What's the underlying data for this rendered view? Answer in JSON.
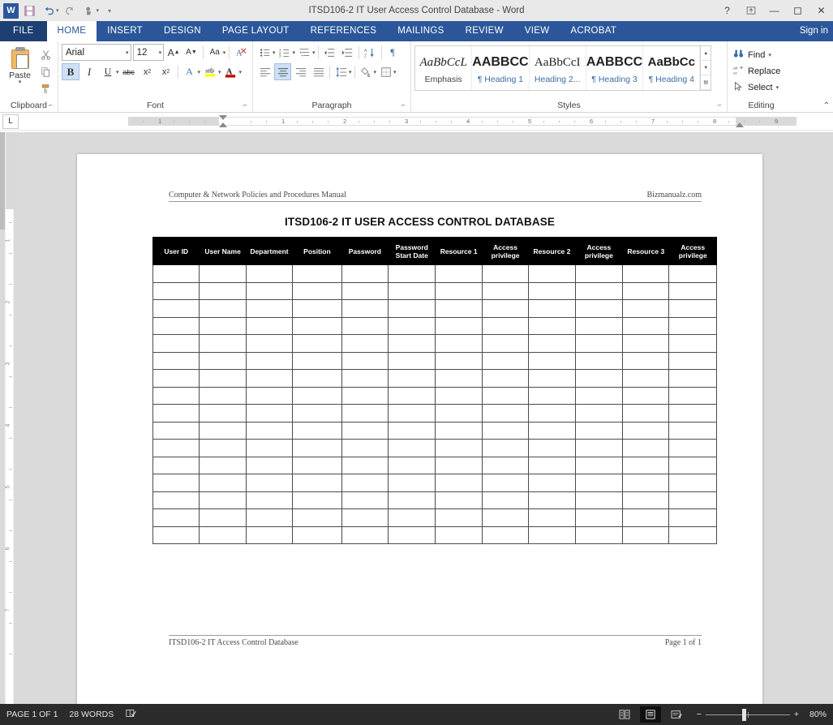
{
  "titlebar": {
    "app_logo": "word-logo",
    "logo_letter": "W",
    "title": "ITSD106-2 IT User Access Control Database - Word",
    "quick_access": [
      {
        "name": "save-icon",
        "label": "Save"
      },
      {
        "name": "undo-icon",
        "label": "Undo"
      },
      {
        "name": "redo-icon",
        "label": "Redo"
      },
      {
        "name": "touch-mode-icon",
        "label": "Touch/Mouse Mode"
      },
      {
        "name": "customize-qat-icon",
        "label": "Customize Quick Access Toolbar"
      }
    ],
    "window_controls": [
      {
        "name": "help-button",
        "glyph": "?"
      },
      {
        "name": "ribbon-display-options-button",
        "glyph": "⬜"
      },
      {
        "name": "minimize-button",
        "glyph": "—"
      },
      {
        "name": "maximize-button",
        "glyph": "▫"
      },
      {
        "name": "close-button",
        "glyph": "✕"
      }
    ]
  },
  "tabs": {
    "file": "FILE",
    "items": [
      {
        "label": "HOME",
        "active": true
      },
      {
        "label": "INSERT",
        "active": false
      },
      {
        "label": "DESIGN",
        "active": false
      },
      {
        "label": "PAGE LAYOUT",
        "active": false
      },
      {
        "label": "REFERENCES",
        "active": false
      },
      {
        "label": "MAILINGS",
        "active": false
      },
      {
        "label": "REVIEW",
        "active": false
      },
      {
        "label": "VIEW",
        "active": false
      },
      {
        "label": "ACROBAT",
        "active": false
      }
    ],
    "signin": "Sign in"
  },
  "ribbon": {
    "clipboard": {
      "group_label": "Clipboard",
      "paste_label": "Paste",
      "buttons": [
        {
          "name": "cut-icon",
          "glyph": "✂"
        },
        {
          "name": "copy-icon",
          "glyph": "⧉"
        },
        {
          "name": "format-painter-icon",
          "glyph": "὘C"
        }
      ]
    },
    "font": {
      "group_label": "Font",
      "font_name": "Arial",
      "font_size": "12",
      "buttons_row1": [
        {
          "name": "grow-font-button",
          "glyph": "A˄"
        },
        {
          "name": "shrink-font-button",
          "glyph": "A˅"
        },
        {
          "name": "change-case-button",
          "glyph": "Aa"
        },
        {
          "name": "clear-formatting-button",
          "glyph": "✐"
        }
      ],
      "buttons_row2": [
        {
          "name": "bold-button",
          "glyph": "B",
          "active": true
        },
        {
          "name": "italic-button",
          "glyph": "I",
          "active": false
        },
        {
          "name": "underline-button",
          "glyph": "U",
          "active": false
        },
        {
          "name": "strikethrough-button",
          "glyph": "abc",
          "active": false
        },
        {
          "name": "subscript-button",
          "glyph": "x₂",
          "active": false
        },
        {
          "name": "superscript-button",
          "glyph": "x²",
          "active": false
        },
        {
          "name": "text-effects-button",
          "glyph": "A",
          "active": false
        },
        {
          "name": "text-highlight-button",
          "glyph": "ab",
          "active": false
        },
        {
          "name": "font-color-button",
          "glyph": "A",
          "active": false
        }
      ]
    },
    "paragraph": {
      "group_label": "Paragraph",
      "buttons_row1": [
        {
          "name": "bullets-button",
          "glyph": "≡"
        },
        {
          "name": "numbering-button",
          "glyph": "≣"
        },
        {
          "name": "multilevel-list-button",
          "glyph": "☷"
        },
        {
          "name": "decrease-indent-button",
          "glyph": "⇤"
        },
        {
          "name": "increase-indent-button",
          "glyph": "⇥"
        },
        {
          "name": "sort-button",
          "glyph": "A↓"
        },
        {
          "name": "show-formatting-marks-button",
          "glyph": "¶"
        }
      ],
      "buttons_row2": [
        {
          "name": "align-left-button",
          "glyph": "≡",
          "active": false
        },
        {
          "name": "align-center-button",
          "glyph": "≡",
          "active": true
        },
        {
          "name": "align-right-button",
          "glyph": "≡",
          "active": false
        },
        {
          "name": "justify-button",
          "glyph": "≡",
          "active": false
        },
        {
          "name": "line-spacing-button",
          "glyph": "↕",
          "active": false
        },
        {
          "name": "shading-button",
          "glyph": "◱",
          "active": false
        },
        {
          "name": "borders-button",
          "glyph": "⊞",
          "active": false
        }
      ]
    },
    "styles": {
      "group_label": "Styles",
      "items": [
        {
          "preview": "AaBbCcL",
          "name": "Emphasis"
        },
        {
          "preview": "AABBCC",
          "name": "¶ Heading 1"
        },
        {
          "preview": "AaBbCcI",
          "name": "Heading 2..."
        },
        {
          "preview": "AABBCC",
          "name": "¶ Heading 3"
        },
        {
          "preview": "AaBbCc",
          "name": "¶ Heading 4"
        }
      ]
    },
    "editing": {
      "group_label": "Editing",
      "items": [
        {
          "name": "find-button",
          "label": "Find",
          "icon": "binoculars-icon",
          "caret": true
        },
        {
          "name": "replace-button",
          "label": "Replace",
          "icon": "replace-icon",
          "caret": false
        },
        {
          "name": "select-button",
          "label": "Select",
          "icon": "cursor-icon",
          "caret": true
        }
      ]
    },
    "collapse_glyph": "⌃"
  },
  "ruler": {
    "tab_selector_glyph": "L",
    "h_numbers": [
      "1",
      "1",
      "2",
      "3",
      "4",
      "5",
      "6",
      "7",
      "8",
      "9"
    ],
    "v_numbers": [
      "1",
      "2",
      "3",
      "4",
      "5",
      "6",
      "7"
    ]
  },
  "document": {
    "header_left": "Computer & Network Policies and Procedures Manual",
    "header_right": "Bizmanualz.com",
    "title": "ITSD106-2   IT USER ACCESS CONTROL DATABASE",
    "table": {
      "columns": [
        "User ID",
        "User Name",
        "Department",
        "Position",
        "Password",
        "Password\nStart Date",
        "Resource 1",
        "Access\nprivilege",
        "Resource 2",
        "Access\nprivilege",
        "Resource 3",
        "Access\nprivilege"
      ],
      "empty_row_count": 16
    },
    "footer_left": "ITSD106-2 IT Access Control Database",
    "footer_right": "Page 1 of 1"
  },
  "statusbar": {
    "page_status": "PAGE 1 OF 1",
    "word_count": "28 WORDS",
    "proofing_icon": "proofing-errors-icon",
    "views": [
      {
        "name": "read-mode-button",
        "glyph": "☷",
        "active": false
      },
      {
        "name": "print-layout-button",
        "glyph": "☰",
        "active": true
      },
      {
        "name": "web-layout-button",
        "glyph": "⌗",
        "active": false
      }
    ],
    "zoom_out_glyph": "−",
    "zoom_in_glyph": "+",
    "zoom_level": "80%"
  }
}
